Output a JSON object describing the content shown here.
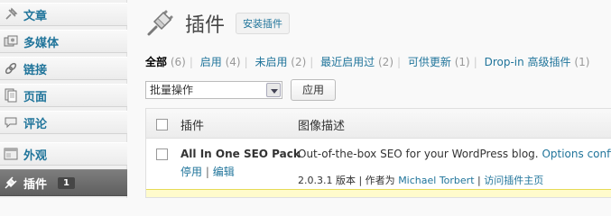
{
  "sidebar": {
    "items": [
      {
        "label": "文章",
        "icon": "pin-icon"
      },
      {
        "label": "多媒体",
        "icon": "media-icon"
      },
      {
        "label": "链接",
        "icon": "link-icon"
      },
      {
        "label": "页面",
        "icon": "page-icon"
      },
      {
        "label": "评论",
        "icon": "comment-icon"
      },
      {
        "label": "外观",
        "icon": "appearance-icon"
      },
      {
        "label": "插件",
        "icon": "plugin-icon",
        "badge": "1",
        "current": true
      }
    ]
  },
  "header": {
    "title": "插件",
    "add_new": "安装插件"
  },
  "filters": [
    {
      "label": "全部",
      "count": "(6)",
      "current": true
    },
    {
      "label": "启用",
      "count": "(4)"
    },
    {
      "label": "未启用",
      "count": "(2)"
    },
    {
      "label": "最近启用过",
      "count": "(2)"
    },
    {
      "label": "可供更新",
      "count": "(1)"
    },
    {
      "label": "Drop-in 高级插件",
      "count": "(1)"
    }
  ],
  "bulk": {
    "selected": "批量操作",
    "apply": "应用"
  },
  "table": {
    "columns": [
      "插件",
      "图像描述"
    ],
    "rows": [
      {
        "name": "All In One SEO Pack",
        "actions": [
          "停用",
          "编辑"
        ],
        "description": "Out-of-the-box SEO for your WordPress blog.",
        "description_more": "Options configurat",
        "version_text": "2.0.3.1 版本 | 作者为",
        "author": "Michael Torbert",
        "plugin_page": "访问插件主页"
      }
    ]
  },
  "colors": {
    "link": "#21759b",
    "current_menu": "#6d6d6d",
    "update_row": "#fffbcc"
  }
}
